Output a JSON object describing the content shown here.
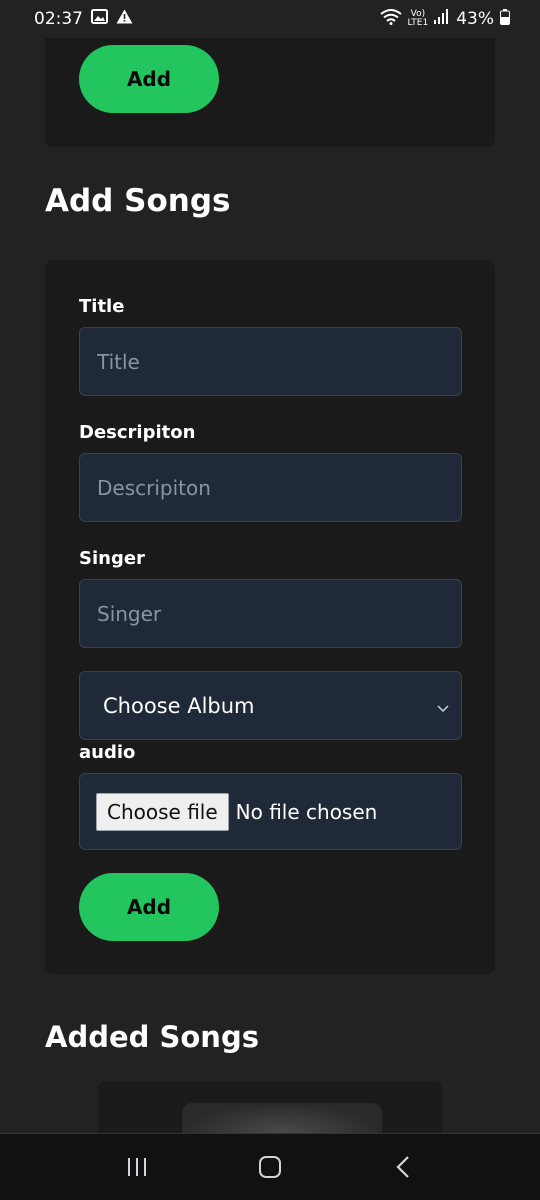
{
  "status_bar": {
    "time": "02:37",
    "battery_percent": "43%",
    "network": "LTE1",
    "left_icons": [
      "gallery-icon",
      "alert-icon"
    ],
    "right_icons": [
      "wifi-icon",
      "volte-icon",
      "signal-icon",
      "battery-icon"
    ]
  },
  "top_card": {
    "add_label": "Add"
  },
  "add_songs": {
    "heading": "Add Songs",
    "title_label": "Title",
    "title_placeholder": "Title",
    "description_label": "Descripiton",
    "description_placeholder": "Descripiton",
    "singer_label": "Singer",
    "singer_placeholder": "Singer",
    "album_select": "Choose Album",
    "audio_label": "audio",
    "file_button": "Choose file",
    "file_status": "No file chosen",
    "add_label": "Add"
  },
  "added_songs": {
    "heading": "Added Songs"
  },
  "colors": {
    "accent": "#22c55e",
    "page_bg": "#222222",
    "card_bg": "#1a1a1a",
    "input_bg": "#1f2937"
  },
  "nav_bar": {
    "icons": [
      "recent-apps-icon",
      "home-icon",
      "back-icon"
    ]
  }
}
